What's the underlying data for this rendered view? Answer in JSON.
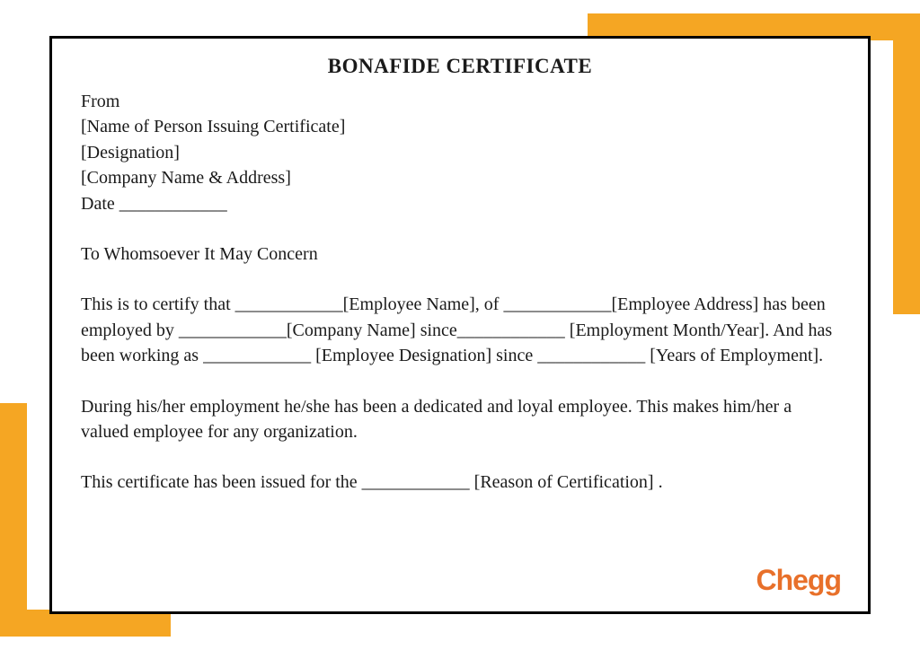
{
  "title": "BONAFIDE CERTIFICATE",
  "from": {
    "label": "From",
    "issuer": "[Name of Person Issuing Certificate]",
    "designation": "[Designation]",
    "company": "[Company Name & Address]",
    "date": "Date ____________"
  },
  "salutation": "To Whomsoever It May Concern",
  "para1": "This is to certify that ____________[Employee Name], of ____________[Employee Address] has been employed by ____________[Company Name] since____________ [Employment Month/Year].  And has been working as ____________ [Employee Designation] since ____________ [Years of Employment].",
  "para2": "During his/her employment he/she has been a dedicated and loyal employee. This makes him/her a valued employee for any organization.",
  "para3": "This certificate has been issued for the ____________ [Reason of Certification] .",
  "logo": "Chegg",
  "colors": {
    "accent": "#f5a623",
    "logo": "#e8702a",
    "text": "#1a1a1a"
  }
}
